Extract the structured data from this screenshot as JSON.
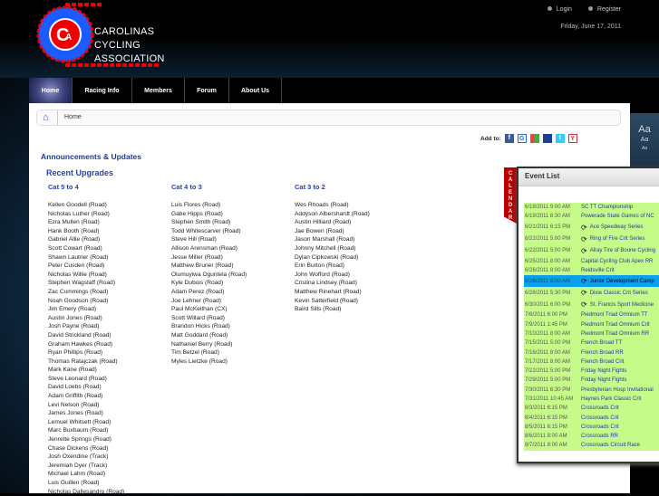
{
  "header": {
    "logo_text": [
      "CAROLINAS",
      "CYCLING",
      "ASSOCIATION"
    ],
    "logo_letters": "CA",
    "links": [
      "Login",
      "Register"
    ],
    "date": "Friday, June 17, 2011"
  },
  "nav": [
    {
      "label": "Home",
      "active": true
    },
    {
      "label": "Racing Info"
    },
    {
      "label": "Members"
    },
    {
      "label": "Forum"
    },
    {
      "label": "About Us"
    }
  ],
  "breadcrumb": {
    "home": "Home"
  },
  "add_to": {
    "label": "Add to:",
    "icons": [
      "facebook-icon",
      "google-icon",
      "msn-icon",
      "myspace-icon",
      "twitter-icon",
      "yahoo-icon"
    ]
  },
  "font_sizer": [
    "Aa",
    "Aa",
    "Aa"
  ],
  "main": {
    "title": "Announcements & Updates",
    "subtitle": "Recent Upgrades",
    "columns": [
      {
        "heading": "Cat 5 to 4",
        "items": [
          "Kellen Goodell (Road)",
          "Nicholas Luther (Road)",
          "Ezra Mullen (Road)",
          "Hank Booth (Road)",
          "Gabriel Allie (Road)",
          "Scott Cowart (Road)",
          "Shawn Lautner (Road)",
          "Peter Cusden (Road)",
          "Nicholas Willie (Road)",
          "Stephen Wagstaff (Road)",
          "Zac Cummings (Road)",
          "Noah Goodson (Road)",
          "Jim Emery (Road)",
          "Austin Jones (Road)",
          "Josh Payne (Road)",
          "David Strickland (Road)",
          "Graham Hawkes (Road)",
          "Ryan Phillips (Road)",
          "Thomas Ratajczak (Road)",
          "Mark Kane (Road)",
          "Steve Leonard (Road)",
          "David Loebs (Road)",
          "Adam Griffith (Road)",
          "Levi Nelson (Road)",
          "James Jones (Road)",
          "Lemuel Whitsett (Road)",
          "Marc Buxbaum (Road)",
          "Jenrette Springs (Road)",
          "Chase Dickens (Road)",
          "Josh Oxendine (Track)",
          "Jeremiah Dyer (Track)",
          "Michael Lahm (Road)",
          "Luis Guillen (Road)",
          "Nicholas Dallesandro (Road)"
        ]
      },
      {
        "heading": "Cat 4 to 3",
        "items": [
          "Luis Flores (Road)",
          "Gabe Hipps (Road)",
          "Stephen Smith (Road)",
          "Todd Whitescarver (Road)",
          "Steve Hill (Road)",
          "Allison Arensman (Road)",
          "Jesse Miller (Road)",
          "Matthew Bruner (Road)",
          "Olumuyiwa Oguntela (Road)",
          "Kyle Dubois (Road)",
          "Adam Perez (Road)",
          "Joe Lehner (Road)",
          "Paul McKeithan (CX)",
          "Scott Willard (Road)",
          "Brandon Hicks (Road)",
          "Matt Goddard (Road)",
          "Nathaniel Berry (Road)",
          "Tim Betzel (Road)",
          "Myles Lietzke (Road)"
        ]
      },
      {
        "heading": "Cat 3 to 2",
        "items": [
          "Wes Rhoads (Road)",
          "Addyson Albershardt (Road)",
          "Austin Hilliard (Road)",
          "Jae Bowen (Road)",
          "Jason Marshall (Road)",
          "Johnny Mitchell (Road)",
          "Dylan Cipkowski (Road)",
          "Erin Burton (Road)",
          "John Wofford (Road)",
          "Cristina Lindsey (Road)",
          "Matthew Rinehart (Road)",
          "Kevin Satterfield (Road)",
          "Baird Sills (Road)"
        ]
      }
    ]
  },
  "calendar": {
    "tab": "CALENDAR",
    "title": "Event List",
    "events": [
      {
        "date": "6/18/2011 9:00 AM",
        "name": "SC TT Championship"
      },
      {
        "date": "6/19/2011 8:30 AM",
        "name": "Powerade State Games of NC"
      },
      {
        "date": "6/21/2011 6:15 PM",
        "name": "Ace Speedway Series",
        "recurring": true
      },
      {
        "date": "6/22/2011 5:00 PM",
        "name": "Ring of Fire Crit Series",
        "recurring": true
      },
      {
        "date": "6/22/2011 5:00 PM",
        "name": "Alray Tire of Boone Cycling",
        "recurring": true
      },
      {
        "date": "6/25/2011 8:00 AM",
        "name": "Capital Cycling Club Apex RR"
      },
      {
        "date": "6/26/2011 8:00 AM",
        "name": "Reidsville Crit"
      },
      {
        "date": "6/26/2011 8:00 AM",
        "name": "Junior Development Camp",
        "recurring": true,
        "selected": true
      },
      {
        "date": "6/28/2011 5:30 PM",
        "name": "Dixie Classic Crit Series",
        "recurring": true
      },
      {
        "date": "6/30/2011 6:00 PM",
        "name": "St. Francis Sport Medicine",
        "recurring": true
      },
      {
        "date": "7/8/2011 6:00 PM",
        "name": "Piedmont Triad Omnium TT"
      },
      {
        "date": "7/9/2011 1:45 PM",
        "name": "Piedmont Triad Omnium Crit"
      },
      {
        "date": "7/10/2011 8:00 AM",
        "name": "Piedmont Triad Omnium RR"
      },
      {
        "date": "7/15/2011 5:00 PM",
        "name": "French Broad TT"
      },
      {
        "date": "7/16/2011 8:00 AM",
        "name": "French Broad RR"
      },
      {
        "date": "7/17/2011 8:00 AM",
        "name": "French Broad Crit"
      },
      {
        "date": "7/22/2011 5:00 PM",
        "name": "Friday Night Fights"
      },
      {
        "date": "7/29/2011 5:00 PM",
        "name": "Friday Night Fights"
      },
      {
        "date": "7/30/2011 6:30 PM",
        "name": "Presbyterian Hosp Invitational"
      },
      {
        "date": "7/31/2011 10:45 AM",
        "name": "Haynes Park Classic Crit"
      },
      {
        "date": "8/3/2011 6:15 PM",
        "name": "Crossroads Crit"
      },
      {
        "date": "8/4/2011 6:15 PM",
        "name": "Crossroads Crit"
      },
      {
        "date": "8/5/2011 6:15 PM",
        "name": "Crossroads Crit"
      },
      {
        "date": "8/6/2011 8:00 AM",
        "name": "Crossroads RR"
      },
      {
        "date": "8/7/2011 8:00 AM",
        "name": "Crossroads Circuit Race"
      }
    ]
  },
  "colors": {
    "link": "#2a3fb0",
    "event_bg": "#c6fb8a",
    "selected": "#0aa0ee",
    "calendar_tab": "#bb0000"
  }
}
